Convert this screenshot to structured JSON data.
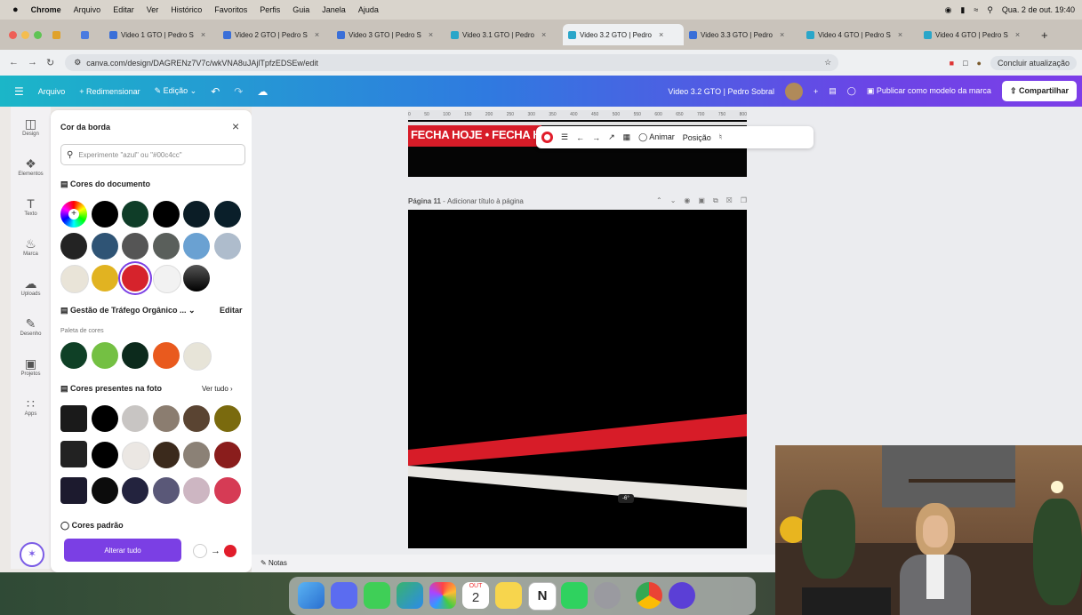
{
  "menubar": {
    "items": [
      "Chrome",
      "Arquivo",
      "Editar",
      "Ver",
      "Histórico",
      "Favoritos",
      "Perfis",
      "Guia",
      "Janela",
      "Ajuda"
    ],
    "datetime": "Qua. 2 de out. 19:40"
  },
  "tabs": [
    {
      "label": "Video 1 GTO | Pedro S"
    },
    {
      "label": "Video 2 GTO | Pedro S"
    },
    {
      "label": "Video 3 GTO | Pedro S"
    },
    {
      "label": "Video 3.1 GTO | Pedro"
    },
    {
      "label": "Video 3.2 GTO | Pedro",
      "active": true
    },
    {
      "label": "Video 3.3 GTO | Pedro"
    },
    {
      "label": "Video 4 GTO | Pedro S"
    },
    {
      "label": "Video 4 GTO | Pedro S"
    }
  ],
  "address": {
    "url": "canva.com/design/DAGRENz7V7c/wkVNA8uJAjlTpfzEDSEw/edit",
    "update_label": "Concluir atualização"
  },
  "header": {
    "menu": [
      "Arquivo",
      "Redimensionar",
      "Edição"
    ],
    "title": "Video 3.2 GTO | Pedro Sobral",
    "publish": "Publicar como modelo da marca",
    "share": "Compartilhar"
  },
  "rail": [
    {
      "icon": "design-icon",
      "label": "Design"
    },
    {
      "icon": "elements-icon",
      "label": "Elementos"
    },
    {
      "icon": "text-icon",
      "label": "Texto"
    },
    {
      "icon": "brand-icon",
      "label": "Marca"
    },
    {
      "icon": "uploads-icon",
      "label": "Uploads"
    },
    {
      "icon": "draw-icon",
      "label": "Desenho"
    },
    {
      "icon": "projects-icon",
      "label": "Projetos"
    },
    {
      "icon": "apps-icon",
      "label": "Apps"
    }
  ],
  "panel": {
    "title": "Cor da borda",
    "search_placeholder": "Experimente \"azul\" ou \"#00c4cc\"",
    "doc_colors_title": "Cores do documento",
    "doc_colors": [
      "#000000",
      "#0f3d28",
      "#000000",
      "#0b1d26",
      "#0a1f2a",
      "#232323",
      "#2f5475",
      "#555555",
      "#5a5f5b",
      "#6aa1d2",
      "#aebccc",
      "#e9e4d8",
      "#e1b321",
      "#d6232c",
      "#f2f2f2",
      "#2a2a2a"
    ],
    "brand_kit": "Gestão de Tráfego Orgânico ...",
    "edit": "Editar",
    "palette_label": "Paleta de cores",
    "palette": [
      "#0f4026",
      "#74c043",
      "#0c2a1c",
      "#e95a1e",
      "#e7e4d8"
    ],
    "photo_colors_title": "Cores presentes na foto",
    "see_all": "Ver tudo",
    "photo_rows": [
      [
        "#000000",
        "#c8c5c3",
        "#8b7d70",
        "#5a4432",
        "#7a6a0e"
      ],
      [
        "#000000",
        "#ebe7e3",
        "#3b2a1c",
        "#8b8176",
        "#8a1d1c"
      ],
      [
        "#0c0c0c",
        "#23233e",
        "#5a5878",
        "#cdb6c2",
        "#d63b55"
      ]
    ],
    "default_colors_title": "Cores padrão",
    "replace_all": "Alterar tudo"
  },
  "canvas": {
    "ruler_ticks": [
      "0",
      "50",
      "100",
      "150",
      "200",
      "250",
      "300",
      "350",
      "400",
      "450",
      "500",
      "550",
      "600",
      "650",
      "700",
      "750",
      "800"
    ],
    "banner_text": "FECHA HOJE • FECHA HO",
    "toolbar": {
      "animate": "Animar",
      "position": "Posição"
    },
    "page_label": "Página 11",
    "page_title_placeholder": "Adicionar título à página",
    "angle_badge": "-6°",
    "notes": "Notas"
  },
  "dock": {
    "calendar_month": "OUT",
    "calendar_day": "2"
  }
}
